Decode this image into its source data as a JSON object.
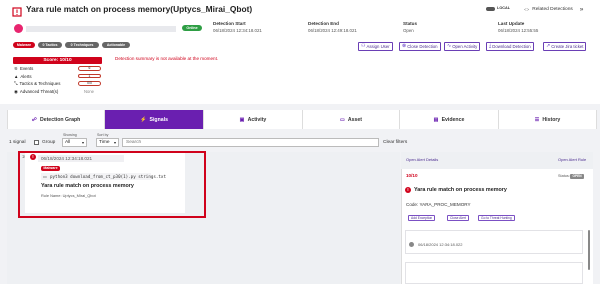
{
  "header": {
    "title": "Yara rule match on process memory(Uptycs_Mirai_Qbot)",
    "env_label": "LOCAL",
    "related_label": "Related Detections",
    "status_badge": "Online",
    "detection_start_label": "Detection Start",
    "detection_start_value": "06/18/2024 12:34:18.021",
    "detection_end_label": "Detection End",
    "detection_end_value": "06/18/2024 12:49:18.021",
    "status_label": "Status",
    "status_value": "Open",
    "last_update_label": "Last Update",
    "last_update_value": "06/18/2024 12:55:55"
  },
  "tags": [
    "Malware",
    "0 Tactics",
    "0 Techniques",
    "Actionable"
  ],
  "score": {
    "label": "Score: 10/10",
    "rows": [
      {
        "label": "Events",
        "value": "6"
      },
      {
        "label": "Alerts",
        "value": "1"
      },
      {
        "label": "Tactics & Techniques",
        "value": "0/0"
      }
    ],
    "advanced_label": "Advanced Threat(s)",
    "advanced_value": "None"
  },
  "summary_message": "Detection summary is not available at the moment.",
  "actions": [
    "Assign User",
    "Close Detection",
    "Open Activity",
    "Download Detection",
    "Create Jira ticket"
  ],
  "tabs": [
    "Detection Graph",
    "Signals",
    "Activity",
    "Asset",
    "Evidence",
    "History"
  ],
  "toolbar": {
    "signal_count": "1 signal",
    "group_label": "Group",
    "showing_label": "Showing",
    "showing_value": "All",
    "sort_label": "Sort by",
    "sort_value": "Time",
    "search_placeholder": "Search",
    "clear_label": "Clear filters"
  },
  "signal": {
    "index": "10",
    "timestamp": "06/18/2024 12:34:18.021",
    "tag": "Malware",
    "command": "python3 download_from_ct_p30(1).py strings.txt",
    "title": "Yara rule match on process memory",
    "rule_name": "Rule Name: Uptycs_Mirai_Qbot"
  },
  "detail": {
    "open_details": "Open Alert Details",
    "open_rule": "Open Alert Rule",
    "score": "10/10",
    "status_label": "Status:",
    "status_value": "OPEN",
    "title": "Yara rule match on process memory",
    "code": "Code: YARA_PROC_MEMORY",
    "buttons": [
      "Add Exception",
      "Close Alert",
      "Go to Threat Hunting"
    ],
    "event_time": "06/18/2024 12:34:18.022"
  },
  "colors": {
    "accent": "#6a1fb0",
    "danger": "#d0021b",
    "online": "#2e9e44"
  }
}
